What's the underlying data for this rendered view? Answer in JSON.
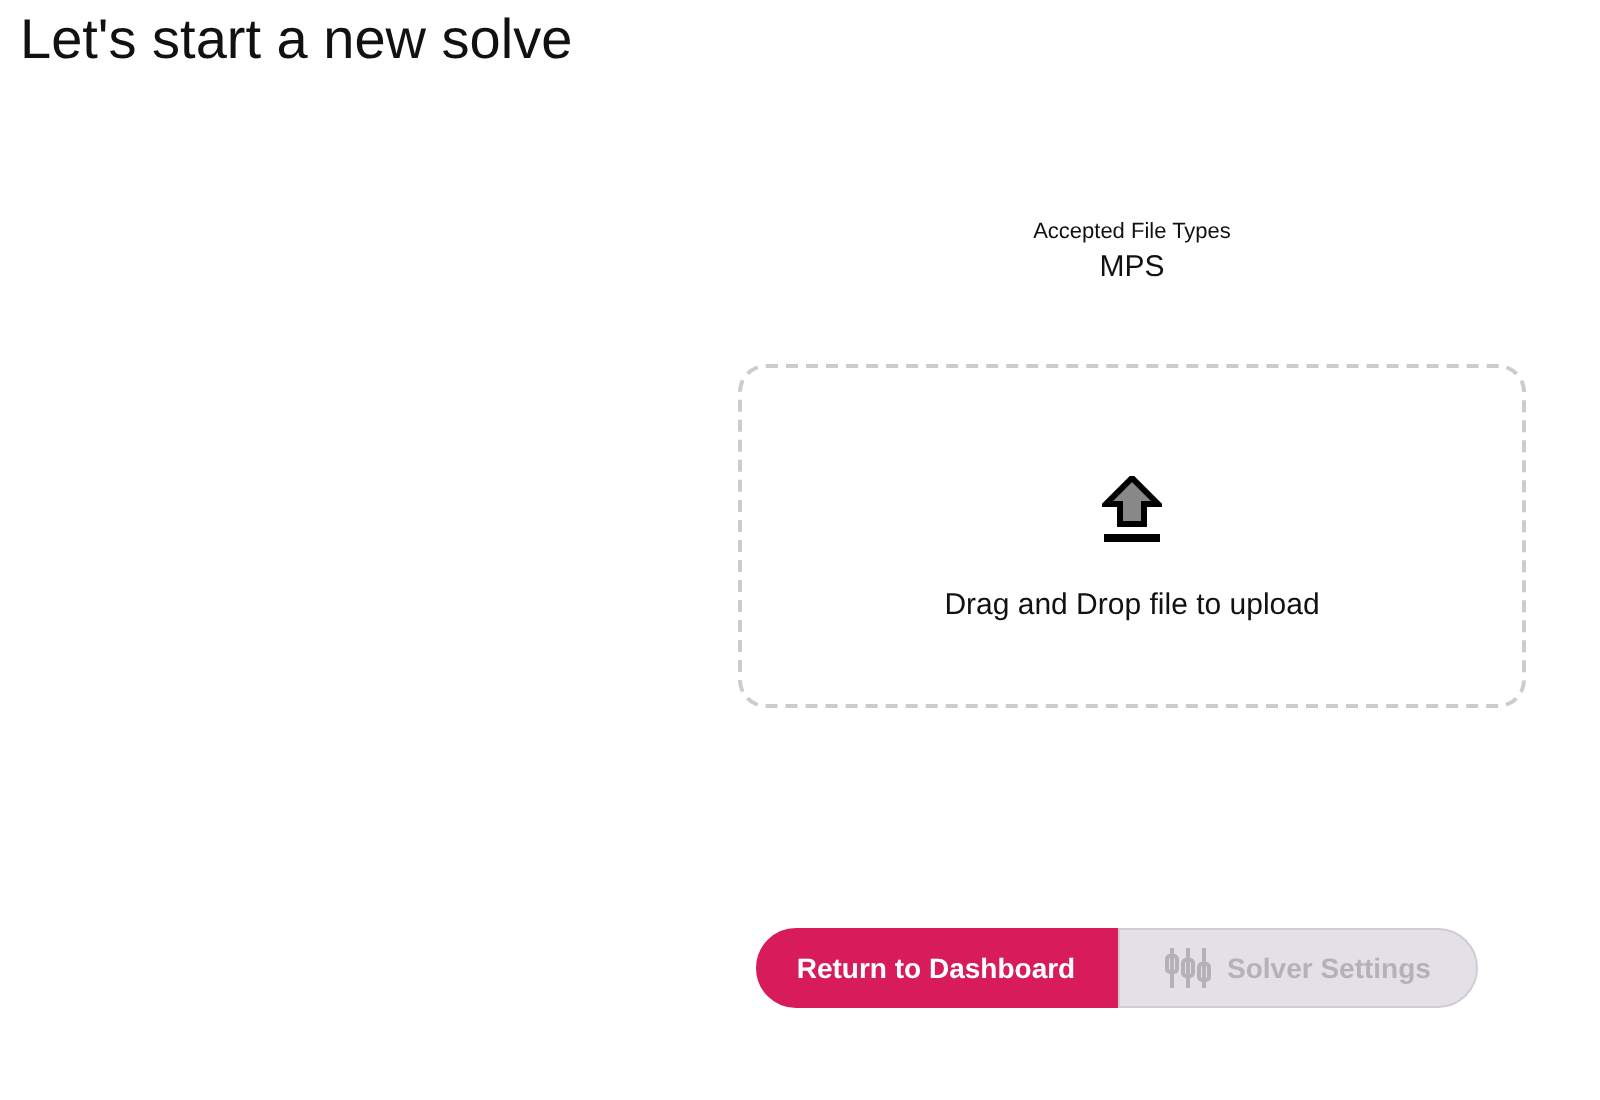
{
  "title": "Let's start a new solve",
  "accepted": {
    "label": "Accepted File Types",
    "types": "MPS"
  },
  "dropzone": {
    "text": "Drag and Drop file to upload"
  },
  "buttons": [
    {
      "kind": "primary",
      "label": "Return to Dashboard",
      "disabled": false
    },
    {
      "kind": "settings",
      "label": "Solver Settings",
      "disabled": true
    }
  ]
}
